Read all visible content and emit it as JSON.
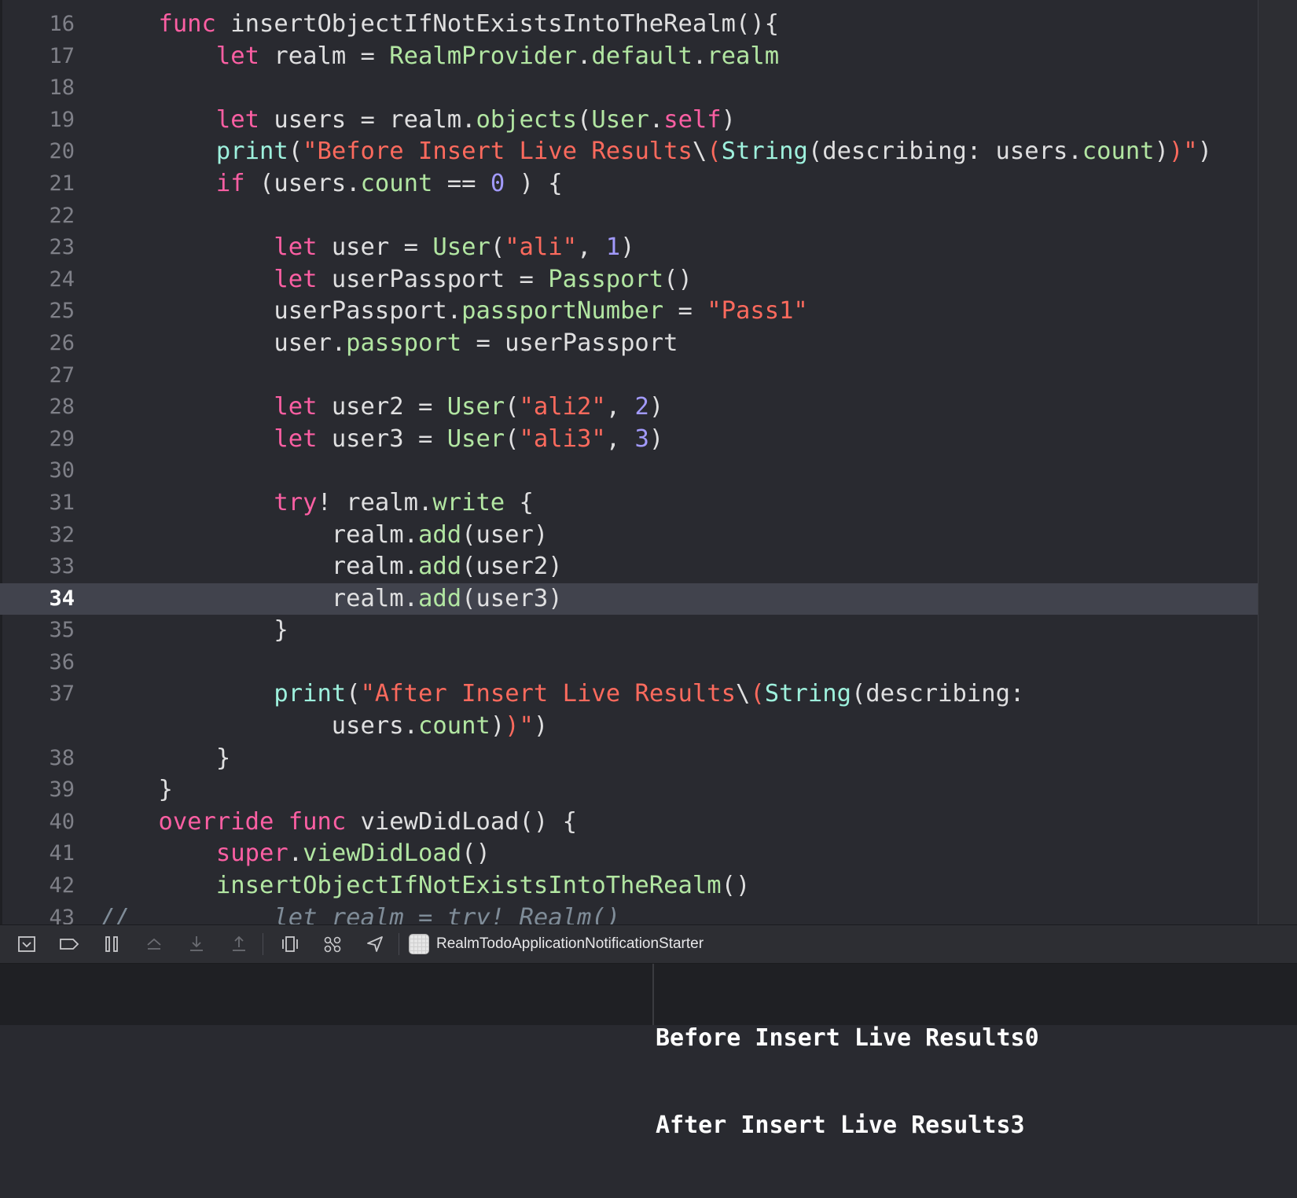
{
  "editor": {
    "lines": [
      {
        "n": "16",
        "current": false,
        "tokens": [
          [
            "p",
            "    "
          ],
          [
            "kw",
            "func"
          ],
          [
            "p",
            " insertObjectIfNotExistsIntoTheRealm(){"
          ]
        ]
      },
      {
        "n": "17",
        "current": false,
        "tokens": [
          [
            "p",
            "        "
          ],
          [
            "kw",
            "let"
          ],
          [
            "p",
            " realm = "
          ],
          [
            "fn",
            "RealmProvider"
          ],
          [
            "p",
            "."
          ],
          [
            "fn",
            "default"
          ],
          [
            "p",
            "."
          ],
          [
            "fn",
            "realm"
          ]
        ]
      },
      {
        "n": "18",
        "current": false,
        "tokens": []
      },
      {
        "n": "19",
        "current": false,
        "tokens": [
          [
            "p",
            "        "
          ],
          [
            "kw",
            "let"
          ],
          [
            "p",
            " users = realm."
          ],
          [
            "fn",
            "objects"
          ],
          [
            "p",
            "("
          ],
          [
            "fn",
            "User"
          ],
          [
            "p",
            "."
          ],
          [
            "kw",
            "self"
          ],
          [
            "p",
            ")"
          ]
        ]
      },
      {
        "n": "20",
        "current": false,
        "tokens": [
          [
            "p",
            "        "
          ],
          [
            "tp",
            "print"
          ],
          [
            "p",
            "("
          ],
          [
            "st",
            "\"Before Insert Live Results"
          ],
          [
            "p",
            "\\"
          ],
          [
            "st",
            "("
          ],
          [
            "tp",
            "String"
          ],
          [
            "p",
            "(describing: users."
          ],
          [
            "fn",
            "count"
          ],
          [
            "p",
            ")"
          ],
          [
            "st",
            ")\""
          ],
          [
            "p",
            ")"
          ]
        ]
      },
      {
        "n": "21",
        "current": false,
        "tokens": [
          [
            "p",
            "        "
          ],
          [
            "kw",
            "if"
          ],
          [
            "p",
            " (users."
          ],
          [
            "fn",
            "count"
          ],
          [
            "p",
            " == "
          ],
          [
            "nm2",
            "0"
          ],
          [
            "p",
            " ) {"
          ]
        ]
      },
      {
        "n": "22",
        "current": false,
        "tokens": []
      },
      {
        "n": "23",
        "current": false,
        "tokens": [
          [
            "p",
            "            "
          ],
          [
            "kw",
            "let"
          ],
          [
            "p",
            " user = "
          ],
          [
            "fn",
            "User"
          ],
          [
            "p",
            "("
          ],
          [
            "st",
            "\"ali\""
          ],
          [
            "p",
            ", "
          ],
          [
            "nm2",
            "1"
          ],
          [
            "p",
            ")"
          ]
        ]
      },
      {
        "n": "24",
        "current": false,
        "tokens": [
          [
            "p",
            "            "
          ],
          [
            "kw",
            "let"
          ],
          [
            "p",
            " userPassport = "
          ],
          [
            "fn",
            "Passport"
          ],
          [
            "p",
            "()"
          ]
        ]
      },
      {
        "n": "25",
        "current": false,
        "tokens": [
          [
            "p",
            "            userPassport."
          ],
          [
            "fn",
            "passportNumber"
          ],
          [
            "p",
            " = "
          ],
          [
            "st",
            "\"Pass1\""
          ]
        ]
      },
      {
        "n": "26",
        "current": false,
        "tokens": [
          [
            "p",
            "            user."
          ],
          [
            "fn",
            "passport"
          ],
          [
            "p",
            " = userPassport"
          ]
        ]
      },
      {
        "n": "27",
        "current": false,
        "tokens": []
      },
      {
        "n": "28",
        "current": false,
        "tokens": [
          [
            "p",
            "            "
          ],
          [
            "kw",
            "let"
          ],
          [
            "p",
            " user2 = "
          ],
          [
            "fn",
            "User"
          ],
          [
            "p",
            "("
          ],
          [
            "st",
            "\"ali2\""
          ],
          [
            "p",
            ", "
          ],
          [
            "nm2",
            "2"
          ],
          [
            "p",
            ")"
          ]
        ]
      },
      {
        "n": "29",
        "current": false,
        "tokens": [
          [
            "p",
            "            "
          ],
          [
            "kw",
            "let"
          ],
          [
            "p",
            " user3 = "
          ],
          [
            "fn",
            "User"
          ],
          [
            "p",
            "("
          ],
          [
            "st",
            "\"ali3\""
          ],
          [
            "p",
            ", "
          ],
          [
            "nm2",
            "3"
          ],
          [
            "p",
            ")"
          ]
        ]
      },
      {
        "n": "30",
        "current": false,
        "tokens": []
      },
      {
        "n": "31",
        "current": false,
        "tokens": [
          [
            "p",
            "            "
          ],
          [
            "kw",
            "try"
          ],
          [
            "p",
            "! realm."
          ],
          [
            "fn",
            "write"
          ],
          [
            "p",
            " {"
          ]
        ]
      },
      {
        "n": "32",
        "current": false,
        "tokens": [
          [
            "p",
            "                realm."
          ],
          [
            "fn",
            "add"
          ],
          [
            "p",
            "(user)"
          ]
        ]
      },
      {
        "n": "33",
        "current": false,
        "tokens": [
          [
            "p",
            "                realm."
          ],
          [
            "fn",
            "add"
          ],
          [
            "p",
            "(user2)"
          ]
        ]
      },
      {
        "n": "34",
        "current": true,
        "tokens": [
          [
            "p",
            "                realm."
          ],
          [
            "fn",
            "add"
          ],
          [
            "p",
            "(user3)"
          ]
        ]
      },
      {
        "n": "35",
        "current": false,
        "tokens": [
          [
            "p",
            "            }"
          ]
        ]
      },
      {
        "n": "36",
        "current": false,
        "tokens": []
      },
      {
        "n": "37",
        "current": false,
        "tokens": [
          [
            "p",
            "            "
          ],
          [
            "tp",
            "print"
          ],
          [
            "p",
            "("
          ],
          [
            "st",
            "\"After Insert Live Results"
          ],
          [
            "p",
            "\\"
          ],
          [
            "st",
            "("
          ],
          [
            "tp",
            "String"
          ],
          [
            "p",
            "(describing:"
          ]
        ]
      },
      {
        "n": "",
        "current": false,
        "tokens": [
          [
            "p",
            "                users."
          ],
          [
            "fn",
            "count"
          ],
          [
            "p",
            ")"
          ],
          [
            "st",
            ")\""
          ],
          [
            "p",
            ")"
          ]
        ]
      },
      {
        "n": "38",
        "current": false,
        "tokens": [
          [
            "p",
            "        }"
          ]
        ]
      },
      {
        "n": "39",
        "current": false,
        "tokens": [
          [
            "p",
            "    }"
          ]
        ]
      },
      {
        "n": "40",
        "current": false,
        "tokens": [
          [
            "p",
            "    "
          ],
          [
            "kw",
            "override"
          ],
          [
            "p",
            " "
          ],
          [
            "kw",
            "func"
          ],
          [
            "p",
            " viewDidLoad() {"
          ]
        ]
      },
      {
        "n": "41",
        "current": false,
        "tokens": [
          [
            "p",
            "        "
          ],
          [
            "kw",
            "super"
          ],
          [
            "p",
            "."
          ],
          [
            "fn",
            "viewDidLoad"
          ],
          [
            "p",
            "()"
          ]
        ]
      },
      {
        "n": "42",
        "current": false,
        "tokens": [
          [
            "p",
            "        "
          ],
          [
            "fn",
            "insertObjectIfNotExistsIntoTheRealm"
          ],
          [
            "p",
            "()"
          ]
        ]
      },
      {
        "n": "43",
        "current": false,
        "tokens": [
          [
            "cm",
            "//          let realm = try! Realm()"
          ]
        ]
      }
    ]
  },
  "debug_toolbar": {
    "buttons": [
      {
        "name": "hide-debug-area-button",
        "icon": "hide-debug-area-icon"
      },
      {
        "name": "toggle-breakpoints-button",
        "icon": "breakpoint-icon"
      },
      {
        "name": "pause-button",
        "icon": "pause-icon"
      },
      {
        "name": "step-over-button",
        "icon": "step-over-icon"
      },
      {
        "name": "step-into-button",
        "icon": "step-into-icon"
      },
      {
        "name": "step-out-button",
        "icon": "step-out-icon"
      },
      {
        "name": "debug-view-hierarchy-button",
        "icon": "view-hierarchy-icon"
      },
      {
        "name": "debug-memory-graph-button",
        "icon": "memory-graph-icon"
      },
      {
        "name": "simulate-location-button",
        "icon": "location-arrow-icon"
      }
    ],
    "target_name": "RealmTodoApplicationNotificationStarter"
  },
  "console": {
    "lines": [
      "Before Insert Live Results0",
      "After Insert Live Results3"
    ]
  }
}
